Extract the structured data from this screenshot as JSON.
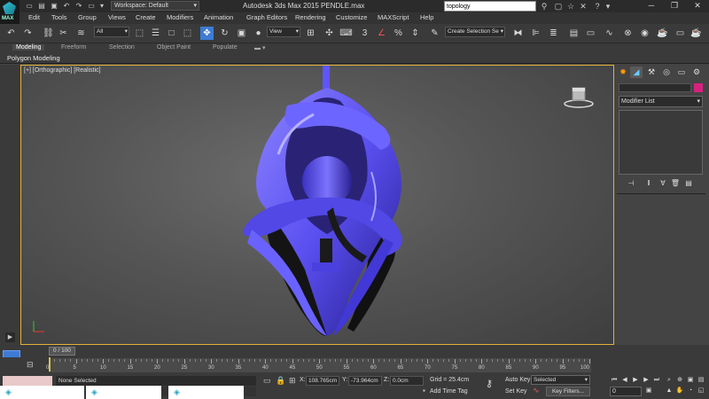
{
  "titlebar": {
    "app_logo_text": "MAX",
    "workspace": "Workspace: Default",
    "title": "Autodesk 3ds Max 2015     PENDLE.max",
    "search_value": "topology"
  },
  "menu": [
    "Edit",
    "Tools",
    "Group",
    "Views",
    "Create",
    "Modifiers",
    "Animation",
    "Graph Editors",
    "Rendering",
    "Customize",
    "MAXScript",
    "Help"
  ],
  "toolbar": {
    "filter_value": "All",
    "ref_coord": "View",
    "selection_set_placeholder": "Create Selection Se"
  },
  "ribbon": {
    "tabs": [
      "Modeling",
      "Freeform",
      "Selection",
      "Object Paint",
      "Populate"
    ],
    "active_panel": "Polygon Modeling"
  },
  "viewport": {
    "label": "[+] [Orthographic] [Realistic]",
    "object_color": "#5a4ff0",
    "frame_color": "#e0b33b"
  },
  "command_panel": {
    "modifier_list": "Modifier List",
    "object_color": "#d6217e"
  },
  "timeline": {
    "frame_counter": "0 / 100",
    "ticks": [
      "0",
      "5",
      "10",
      "15",
      "20",
      "25",
      "30",
      "35",
      "40",
      "45",
      "50",
      "55",
      "60",
      "65",
      "70",
      "75",
      "80",
      "85",
      "90",
      "95",
      "100"
    ]
  },
  "status": {
    "selection": "None Selected",
    "x_label": "X:",
    "x_value": "108.765cm",
    "y_label": "Y:",
    "y_value": "-73.964cm",
    "z_label": "Z:",
    "z_value": "0.0cm",
    "grid": "Grid = 25.4cm",
    "add_time_tag": "Add Time Tag",
    "auto_key": "Auto Key",
    "set_key": "Set Key",
    "selected": "Selected",
    "key_filters": "Key Filters...",
    "current_frame": "0"
  }
}
